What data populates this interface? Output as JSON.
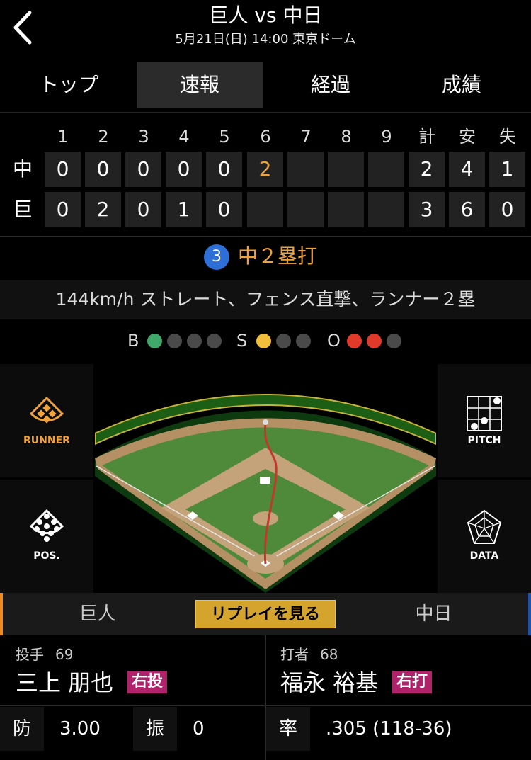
{
  "header": {
    "title": "巨人 vs 中日",
    "subtitle": "5月21日(日) 14:00 東京ドーム"
  },
  "tabs": [
    {
      "label": "トップ",
      "active": false
    },
    {
      "label": "速報",
      "active": true
    },
    {
      "label": "経過",
      "active": false
    },
    {
      "label": "成績",
      "active": false
    }
  ],
  "scoreboard": {
    "headers": [
      "1",
      "2",
      "3",
      "4",
      "5",
      "6",
      "7",
      "8",
      "9",
      "計",
      "安",
      "失"
    ],
    "rows": [
      {
        "team": "中",
        "cells": [
          "0",
          "0",
          "0",
          "0",
          "0",
          "2",
          "",
          "",
          "",
          "2",
          "4",
          "1"
        ]
      },
      {
        "team": "巨",
        "cells": [
          "0",
          "2",
          "0",
          "1",
          "0",
          "",
          "",
          "",
          "",
          "3",
          "6",
          "0"
        ]
      }
    ]
  },
  "play": {
    "number": "3",
    "result": "中２塁打",
    "detail": "144km/h ストレート、フェンス直撃、ランナー２塁"
  },
  "count": {
    "b_label": "B",
    "s_label": "S",
    "o_label": "O",
    "balls": 1,
    "strikes": 1,
    "outs": 2,
    "colors": {
      "ball": "#3fa86a",
      "strike": "#f1bf3b",
      "out": "#e03a2a",
      "off": "#4a4a4a"
    }
  },
  "side_buttons": {
    "runner": "RUNNER",
    "pitch": "PITCH",
    "pos": "POS.",
    "data": "DATA"
  },
  "replay": {
    "left_team": "巨人",
    "button": "リプレイを見る",
    "right_team": "中日"
  },
  "pitcher": {
    "role": "投手",
    "number": "69",
    "name": "三上 朋也",
    "badge": "右投"
  },
  "batter": {
    "role": "打者",
    "number": "68",
    "name": "福永 裕基",
    "badge": "右打"
  },
  "stats": {
    "pitcher_key": "防",
    "pitcher_val": "3.00",
    "k_key": "振",
    "k_val": "0",
    "batter_key": "率",
    "batter_val": ".305 (118-36)"
  },
  "colors": {
    "accent_orange": "#f0a23a",
    "badge_magenta": "#b0226a",
    "replay_gold": "#d4a42c",
    "left_team_bar": "#f08a1c",
    "right_team_bar": "#1f4fa8"
  }
}
